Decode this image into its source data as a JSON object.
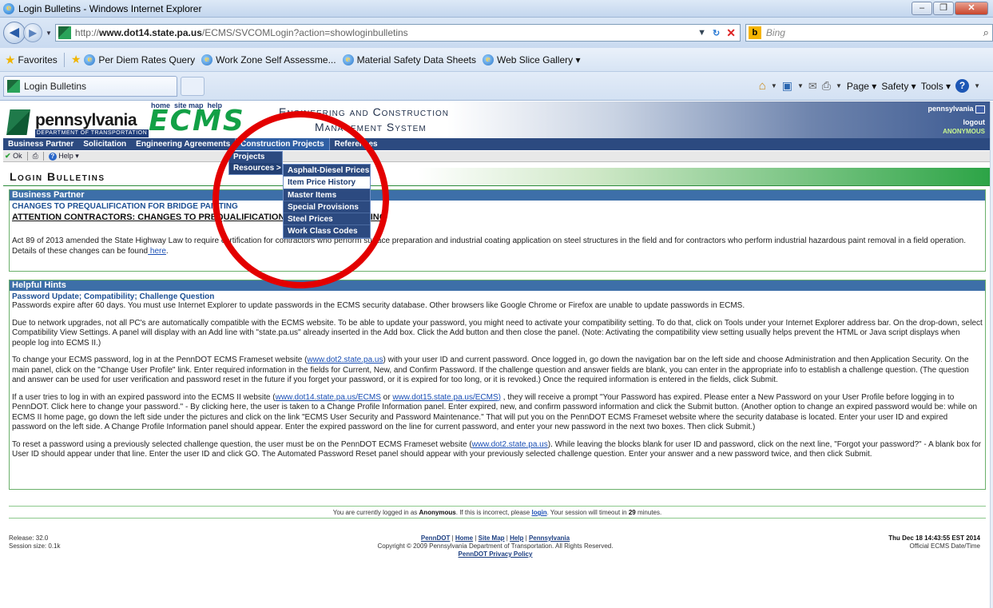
{
  "window": {
    "title": "Login Bulletins - Windows Internet Explorer",
    "min": "–",
    "max": "❐",
    "close": "✕"
  },
  "address": {
    "url_prefix": "http://",
    "url_host": "www.dot14.state.pa.us",
    "url_path": "/ECMS/SVCOMLogin?action=showloginbulletins",
    "search_placeholder": "Bing",
    "search_brand": "b"
  },
  "favorites": {
    "label": "Favorites",
    "items": [
      "Per Diem Rates Query",
      "Work Zone Self Assessme...",
      "Material Safety Data Sheets",
      "Web Slice Gallery ▾"
    ]
  },
  "tabs": {
    "active": "Login Bulletins"
  },
  "commandbar": {
    "page": "Page ▾",
    "safety": "Safety ▾",
    "tools": "Tools ▾",
    "help": "?"
  },
  "header": {
    "brand": "pennsylvania",
    "dept": "DEPARTMENT OF TRANSPORTATION",
    "logo": "ECMS",
    "link_home": "home",
    "link_sitemap": "site map",
    "link_help": "help",
    "title_line1": "Engineering and Construction",
    "title_line2": "Management System",
    "right_brand": "pennsylvania",
    "logout": "logout",
    "user": "ANONYMOUS"
  },
  "menu": {
    "items": [
      "Business Partner",
      "Solicitation",
      "Engineering Agreements",
      "Construction Projects",
      "References"
    ]
  },
  "toolbar": {
    "ok": "Ok",
    "help": "Help ▾"
  },
  "dropdown": {
    "level1": [
      "Projects",
      "Resources >"
    ],
    "level2": [
      "Asphalt-Diesel Prices",
      "Item Price History",
      "Master Items",
      "Special Provisions",
      "Steel Prices",
      "Work Class Codes"
    ]
  },
  "page": {
    "title": "Login Bulletins"
  },
  "bulletin": {
    "head": "Business Partner",
    "sub": "CHANGES TO PREQUALIFICATION FOR BRIDGE PAINTING",
    "attention": "ATTENTION CONTRACTORS:  CHANGES TO PREQUALIFICATION FOR BRIDGE PAINTING",
    "body": "Act 89 of 2013 amended the State Highway Law to require certification for contractors who perform surface preparation and industrial coating application on steel structures in the field and for contractors who perform industrial hazardous paint removal in a field operation.  Details of these changes can be found",
    "link": " here",
    "end": "."
  },
  "hints": {
    "head": "Helpful Hints",
    "sub": "Password Update; Compatibility; Challenge Question",
    "p1": "Passwords expire after 60 days. You must use Internet Explorer to update passwords in the ECMS security database. Other browsers like Google Chrome or Firefox are unable to update passwords in ECMS.",
    "p2": "Due to network upgrades, not all PC's are automatically compatible with the ECMS website. To be able to update your password, you might need to activate your compatibility setting. To do that, click on Tools under your Internet Explorer address bar. On the drop-down, select Compatibility View Settings. A panel will display with an Add line with \"state.pa.us\" already inserted in the Add box. Click the Add button and then close the panel. (Note: Activating the compatibility view setting usually helps prevent the HTML or Java script displays when people log into ECMS II.)",
    "p3a": "To change your ECMS password, log in at the PennDOT ECMS Frameset website (",
    "p3link": "www.dot2.state.pa.us",
    "p3b": ") with your user ID and current password.  Once logged in, go down the navigation bar on the left side and choose Administration and then Application Security.  On the main panel, click on the \"Change User Profile\" link.  Enter required information in the fields for Current, New, and Confirm Password. If the challenge question and answer fields are blank, you can enter in the appropriate info to establish a challenge question. (The question and answer can be used for user verification and password reset in the future if you forget your password, or it is expired for too long, or it is revoked.) Once the required information is entered in the fields, click Submit.",
    "p4a": "If a user tries to log in with an expired password into the ECMS II website (",
    "p4link1": "www.dot14.state.pa.us/ECMS",
    "p4or": "  or  ",
    "p4link2": "www.dot15.state.pa.us/ECMS)",
    "p4b": " , they will receive a prompt \"Your Password has expired. Please enter a New Password on your User Profile before logging in to PennDOT. Click here to change your password.\" - By clicking here, the user is taken to a Change Profile Information panel. Enter expired, new, and confirm password information and click the Submit button. (Another option to change an expired password would be:  while on ECMS II home page, go down the left side under the pictures and click on the link \"ECMS User Security and Password Maintenance.\" That will put you on the PennDOT ECMS Frameset website where the security database is located. Enter your user ID and expired password on the left side. A Change Profile Information panel should appear. Enter the expired password on the line for current password, and enter your new password in the next two boxes. Then click Submit.)",
    "p5a": "To reset a password using a previously selected challenge question, the user must be on the PennDOT ECMS Frameset website (",
    "p5link": "www.dot2.state.pa.us",
    "p5b": "). While leaving the blocks blank for user ID and password, click on the next line, \"Forgot your password?\" - A blank box for User ID should appear under that line. Enter the user ID and click GO. The Automated Password Reset panel should appear with your previously selected challenge question. Enter your answer and a new password twice, and then click Submit."
  },
  "session": {
    "pre": "You are currently logged in as ",
    "user": "Anonymous",
    "mid": ".  If this is incorrect, please ",
    "login": "login",
    "mid2": ".  Your session will timeout in ",
    "minutes": "29",
    "post": " minutes."
  },
  "footer": {
    "release": "Release: 32.0",
    "session_size": "Session size: 0.1k",
    "links": [
      "PennDOT",
      "Home",
      "Site Map",
      "Help",
      "Pennsylvania"
    ],
    "sep": " | ",
    "copyright": "Copyright © 2009 Pennsylvania Department of Transportation. All Rights Reserved.",
    "privacy": "PennDOT Privacy Policy",
    "datetime": "Thu Dec 18 14:43:55 EST 2014",
    "datetime_label": "Official ECMS Date/Time"
  }
}
